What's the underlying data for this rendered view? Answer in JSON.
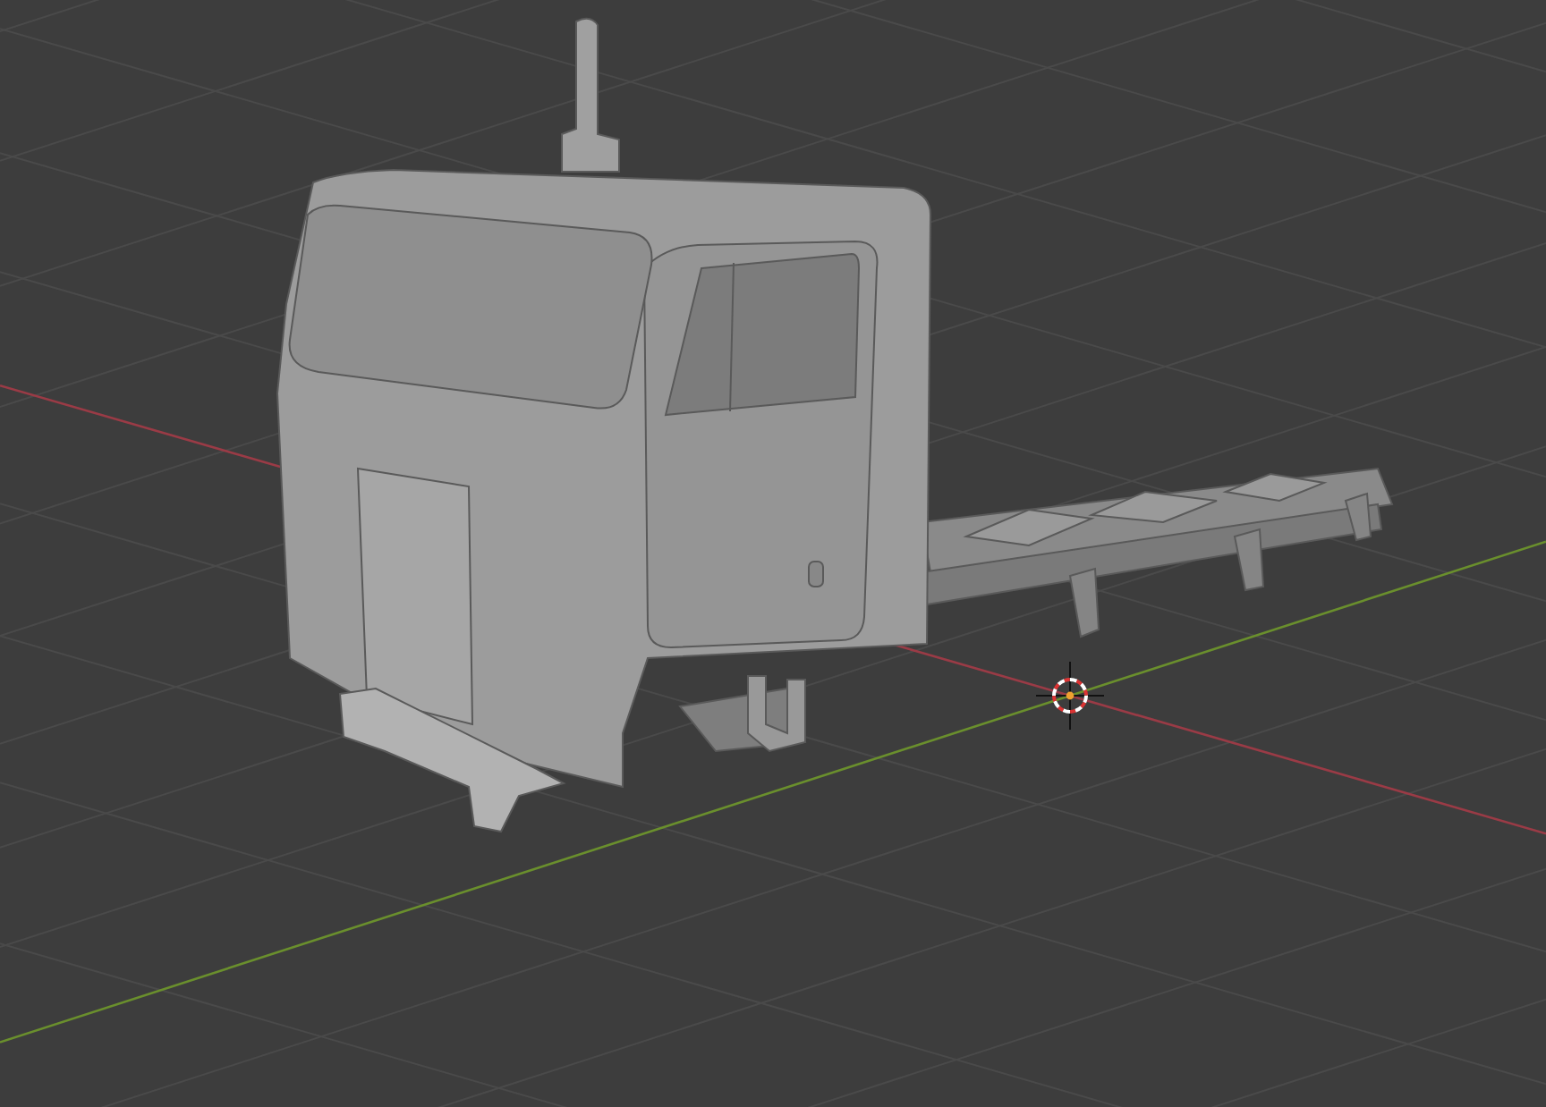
{
  "viewport": {
    "show_grid": true,
    "show_axes": true,
    "show_cursor": true,
    "show_model": true
  }
}
